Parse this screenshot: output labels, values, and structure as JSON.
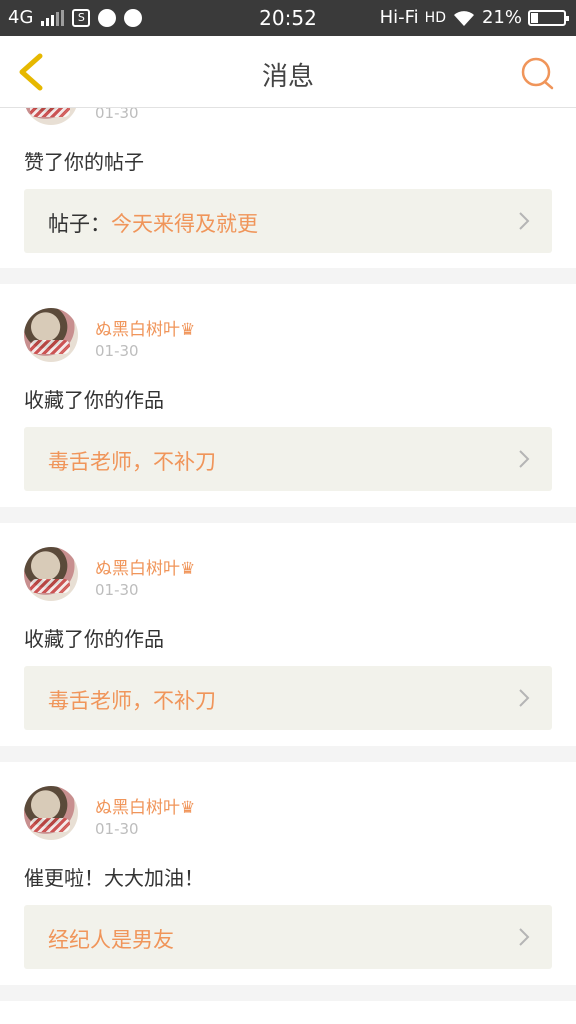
{
  "status": {
    "network": "4G",
    "time": "20:52",
    "wifi_label": "Hi-Fi",
    "hd_label": "HD",
    "battery_percent": "21%"
  },
  "nav": {
    "title": "消息",
    "back_icon": "chevron-left-icon",
    "search_icon": "search-icon"
  },
  "colors": {
    "accent": "#f0955a",
    "back_icon": "#e6b800",
    "link_box_bg": "#f2f2eb"
  },
  "cards": [
    {
      "time": "01-30",
      "action": "赞了你的帖子",
      "link_prefix": "帖子：",
      "link_text": "今天来得及就更"
    },
    {
      "username": "ぬ黑白树叶♛",
      "time": "01-30",
      "action": "收藏了你的作品",
      "link_text": "毒舌老师，不补刀"
    },
    {
      "username": "ぬ黑白树叶♛",
      "time": "01-30",
      "action": "收藏了你的作品",
      "link_text": "毒舌老师，不补刀"
    },
    {
      "username": "ぬ黑白树叶♛",
      "time": "01-30",
      "action": "催更啦！大大加油！",
      "link_text": "经纪人是男友"
    }
  ]
}
